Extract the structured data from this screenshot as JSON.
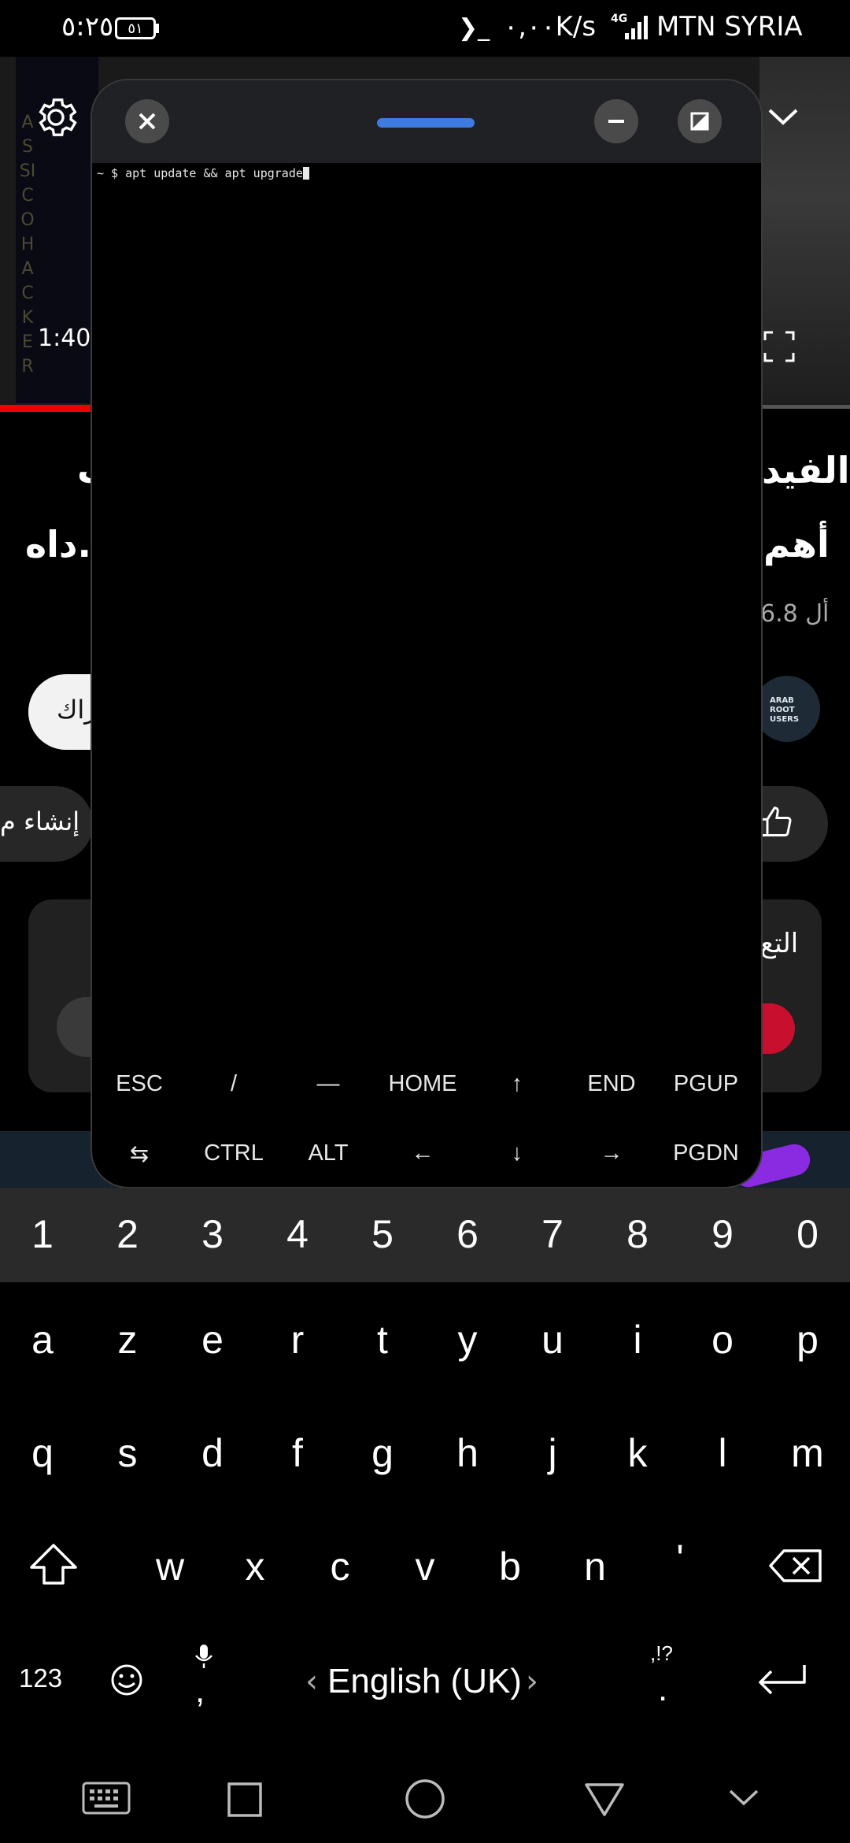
{
  "status_bar": {
    "time": "٥:٢٥",
    "battery": "٥١",
    "terminal_glyph": "❯_",
    "speed": "٠,٠٠K/s",
    "network_type": "4G",
    "carrier": "MTN SYRIA"
  },
  "background_page": {
    "video_time": "1:40",
    "title_line1": "الفيد",
    "title_line1_left": "ب",
    "title_line2": "أهم",
    "title_line2_left": "داه...",
    "views_partial": "6.8 أل",
    "subscribe_partial": "راك",
    "create_partial": "إنشاء م",
    "comments_partial": "التع",
    "vertical_text": "ASSICO HACKER",
    "channel_logo_text": "ARAB ROOT USERS"
  },
  "terminal": {
    "prompt": "~ $ ",
    "command": "apt update && apt upgrade",
    "extra_keys_row1": [
      "ESC",
      "/",
      "—",
      "HOME",
      "↑",
      "END",
      "PGUP"
    ],
    "extra_keys_row2": [
      "⇆",
      "CTRL",
      "ALT",
      "←",
      "↓",
      "→",
      "PGDN"
    ]
  },
  "keyboard": {
    "number_row": [
      "1",
      "2",
      "3",
      "4",
      "5",
      "6",
      "7",
      "8",
      "9",
      "0"
    ],
    "row1": [
      "a",
      "z",
      "e",
      "r",
      "t",
      "y",
      "u",
      "i",
      "o",
      "p"
    ],
    "row2": [
      "q",
      "s",
      "d",
      "f",
      "g",
      "h",
      "j",
      "k",
      "l",
      "m"
    ],
    "row3": [
      "w",
      "x",
      "c",
      "v",
      "b",
      "n",
      "'"
    ],
    "symbols_key": "123",
    "comma_key": ",",
    "language": "English (UK)",
    "punct_top": ",!?",
    "period_key": "."
  },
  "colors": {
    "accent_handle": "#3d7be0",
    "video_progress": "#ee0000"
  }
}
